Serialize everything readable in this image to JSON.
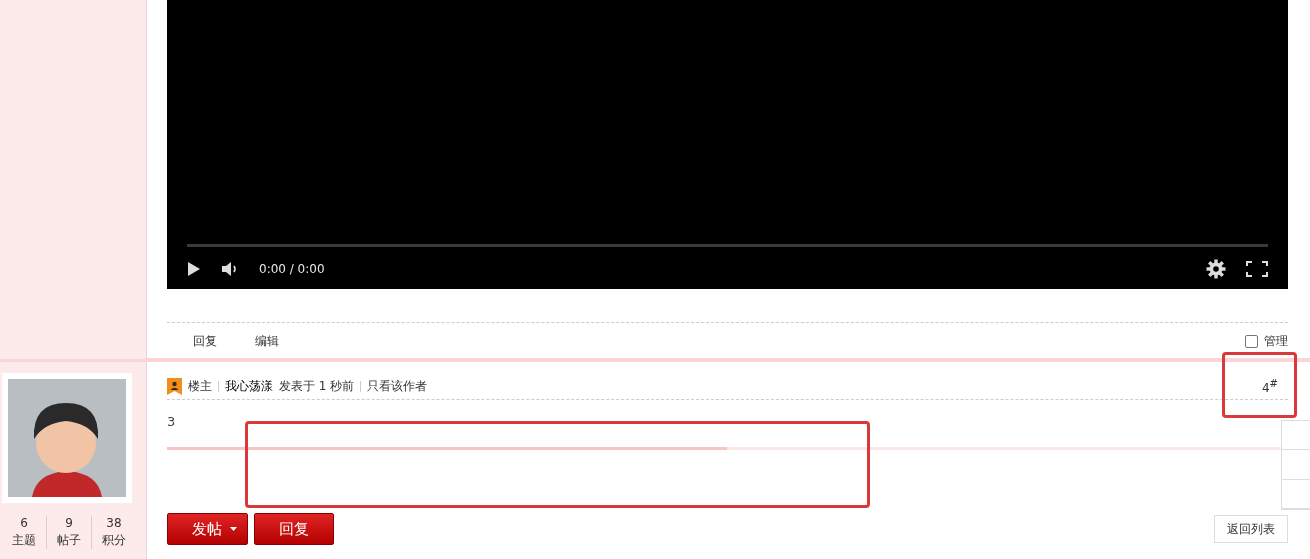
{
  "video": {
    "time": "0:00 / 0:00"
  },
  "post_actions": [
    {
      "label": "回复"
    },
    {
      "label": "编辑"
    }
  ],
  "manage": {
    "label": "管理",
    "checked": false
  },
  "author_stats": [
    {
      "value": "6",
      "label": "主题"
    },
    {
      "value": "9",
      "label": "帖子"
    },
    {
      "value": "38",
      "label": "积分"
    }
  ],
  "post": {
    "role": "楼主",
    "author": "我心荡漾",
    "posted": "发表于 1 秒前",
    "author_only": "只看该作者",
    "floor": "4$^{#}$",
    "content": "3"
  },
  "buttons": [
    {
      "label": "发帖",
      "kind": "dropdown"
    },
    {
      "label": "回复",
      "kind": "plain"
    }
  ],
  "back_button": "返回列表"
}
